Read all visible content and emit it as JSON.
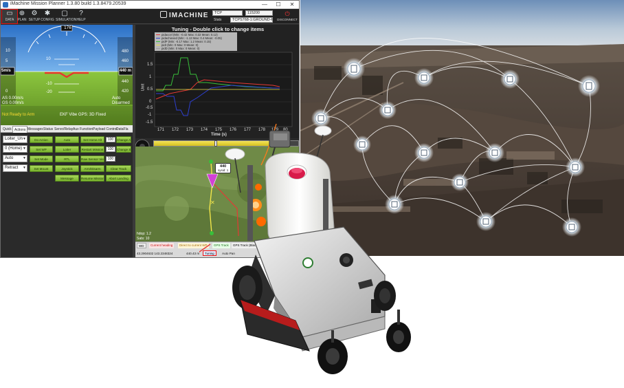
{
  "window": {
    "title": "iMachine Mission Planner 1.3.80 build 1.3.8479.20539",
    "minimize": "—",
    "maximize": "☐",
    "close": "✕"
  },
  "toolbar": {
    "items": [
      {
        "label": "DATA",
        "icon": "monitor-icon",
        "glyph": "▭"
      },
      {
        "label": "PLAN",
        "icon": "map-icon",
        "glyph": "⊕"
      },
      {
        "label": "SETUP",
        "icon": "gear-icon",
        "glyph": "⚙"
      },
      {
        "label": "CONFIG",
        "icon": "wrench-icon",
        "glyph": "✱"
      },
      {
        "label": "SIMULATION",
        "icon": "screen-icon",
        "glyph": "▢"
      },
      {
        "label": "HELP",
        "icon": "help-icon",
        "glyph": "?"
      }
    ],
    "brand": "IMACHINE",
    "connection_type": "TCP",
    "baud": "115200",
    "stats_label": "Stats",
    "port": "TCPS768-1:GROUND-F",
    "disconnect": "DISCONNECT"
  },
  "hud": {
    "heading_label": "176",
    "speed_left": [
      "10",
      "5",
      "0"
    ],
    "speed_current": "5m/s",
    "alt_right": [
      "480",
      "460",
      "440",
      "420"
    ],
    "alt_current": "440 m",
    "pitch_labels": [
      "10",
      "-10",
      "-20"
    ],
    "status_left": "AS 0.00m/s",
    "status_left2": "GS 0.00m/s",
    "status_mid": "EKF  Vibe  GPS: 3D Fixed",
    "status_mode": "Not Ready to Arm",
    "status_right": "Auto",
    "status_right2": "Disarmed"
  },
  "tabs": [
    "Quick",
    "Actions",
    "Messages",
    "Status",
    "Servo/Relay",
    "Aux Function",
    "Payload Control",
    "DataFla"
  ],
  "actions": {
    "combos": [
      "Loiter_Un",
      "0 (Home)",
      "Auto",
      "Retract"
    ],
    "buttons_col1": [
      "Do Action",
      "Set WP",
      "Set Mode",
      "Set Mount"
    ],
    "buttons_col2": [
      "Auto",
      "Loiter",
      "RTL",
      "Joystick",
      "Message"
    ],
    "buttons_col3": [
      "Set Home Alt",
      "Restart Mission",
      "Raw Sensor View",
      "Arm/Disarm",
      "Resume Mission"
    ],
    "buttons_col4": [
      "Change Alt",
      "Change Speed",
      "Clear Track",
      "Abort Landing"
    ],
    "spin_values": [
      "100",
      "100",
      "100",
      "100"
    ]
  },
  "tuning": {
    "title": "Tuning - Double click to change items",
    "legend": [
      {
        "label": "pidaccel (Min: -0.42 Max: 0.32 Mean: 0.12)",
        "color": "#e53935"
      },
      {
        "label": "pidachieved (Min: -1.13 Max: 0.4 Mean: -0.05)",
        "color": "#2d3fd1"
      },
      {
        "label": "pidP (Min: -0.17 Max: 1.2 Mean: 0.15)",
        "color": "#38c03a"
      },
      {
        "label": "pidI (Min: 0 Max: 0 Mean: 0)",
        "color": "#e8e045"
      },
      {
        "label": "pidD (Min: 0 Max: 0 Mean: 0)",
        "color": "#9e9e9e"
      }
    ],
    "ylabel": "Unit",
    "xlabel": "Time (s)",
    "yticks": [
      "1.5",
      "1",
      "0.5",
      "0",
      "-0.5",
      "-1",
      "-1.5"
    ],
    "xticks": [
      "171",
      "172",
      "173",
      "174",
      "175",
      "176",
      "177",
      "178",
      "179",
      "80"
    ]
  },
  "map": {
    "wp_label": "440",
    "wp_sub": "sysid: 1",
    "hdop": "hdop: 1.2",
    "sats": "Sats: 10",
    "warn1": "Current heading",
    "warn2": "Direct to current WP",
    "warn3": "GPS Track",
    "status_mode": "GPS Track (Black"
  },
  "statusbar": {
    "tab_label": "Tuning",
    "coords": "43.2904632 143.2348324",
    "alt_val": "440.43 m",
    "auto_pan": "Auto Pan",
    "prefix": "WD",
    "r1": "Tuning"
  },
  "colors": {
    "accent_red": "#e11111",
    "button_green": "#8fc63c",
    "sky": "#4a8fd6",
    "ground": "#6fa22e",
    "tank": "#f5f5f2",
    "cap": "#d81b4a"
  }
}
